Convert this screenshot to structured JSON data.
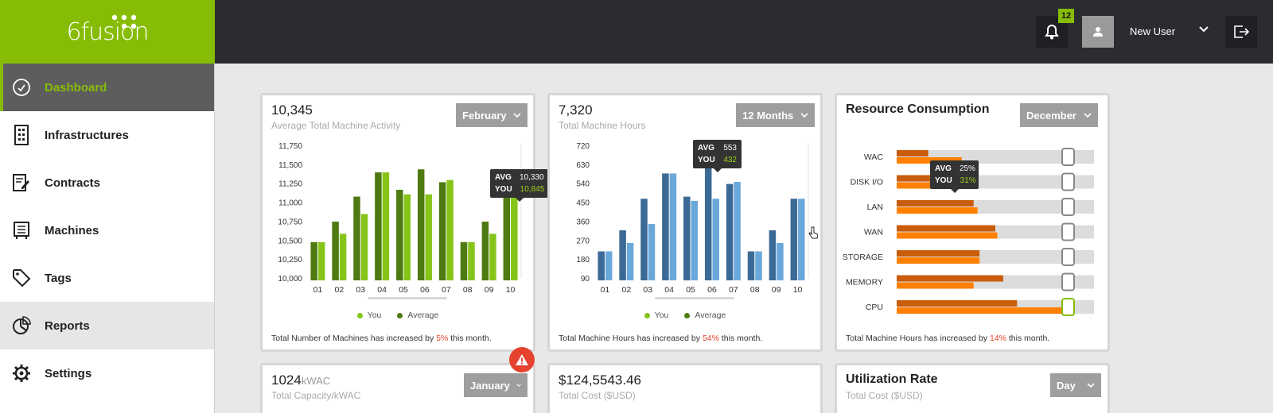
{
  "brand": {
    "logo_text": "6fusion"
  },
  "sidebar": {
    "items": [
      {
        "label": "Dashboard",
        "icon": "dashboard-icon"
      },
      {
        "label": "Infrastructures",
        "icon": "building-icon"
      },
      {
        "label": "Contracts",
        "icon": "contract-icon"
      },
      {
        "label": "Machines",
        "icon": "machine-icon"
      },
      {
        "label": "Tags",
        "icon": "tag-icon"
      },
      {
        "label": "Reports",
        "icon": "pie-chart-icon"
      },
      {
        "label": "Settings",
        "icon": "gear-icon"
      }
    ]
  },
  "topbar": {
    "notification_count": "12",
    "user_name": "New User"
  },
  "colors": {
    "brand_green": "#86bc05",
    "dark": "#2b2c30",
    "alert_red": "#e5432f",
    "avg_green": "#4f7a12",
    "you_green": "#86c41a",
    "avg_blue": "#3c6a96",
    "you_blue": "#6aa8dc",
    "avg_orange": "#c95d0c",
    "you_orange": "#ff8000"
  },
  "cards": {
    "activity": {
      "value": "10,345",
      "subtitle": "Average Total Machine Activity",
      "dropdown": "February",
      "footer_pre": "Total Number of Machines has increased by ",
      "footer_pct": "5%",
      "footer_post": " this month.",
      "tooltip": {
        "avg_label": "AVG",
        "avg": "10,330",
        "you_label": "YOU",
        "you": "10,845"
      },
      "legend": [
        "You",
        "Average"
      ]
    },
    "hours": {
      "value": "7,320",
      "subtitle": "Total Machine Hours",
      "dropdown": "12 Months",
      "footer_pre": "Total Machine Hours has increased by ",
      "footer_pct": "54%",
      "footer_post": " this month.",
      "tooltip": {
        "avg_label": "AVG",
        "avg": "553",
        "you_label": "YOU",
        "you": "432"
      },
      "legend": [
        "You",
        "Average"
      ]
    },
    "resource": {
      "title": "Resource Consumption",
      "dropdown": "December",
      "footer_pre": "Total Machine Hours has increased by ",
      "footer_pct": "14%",
      "footer_post": " this month.",
      "tooltip": {
        "avg_label": "AVG",
        "avg": "25%",
        "you_label": "YOU",
        "you": "31%"
      }
    },
    "capacity": {
      "value": "1024",
      "unit": "kWAC",
      "subtitle": "Total Capacity/kWAC",
      "dropdown": "January"
    },
    "cost": {
      "value": "$124,5543.46",
      "subtitle": "Total Cost ($USD)"
    },
    "utilization": {
      "title": "Utilization Rate",
      "subtitle": "Total Cost ($USD)",
      "dropdown": "Day"
    }
  },
  "chart_data": [
    {
      "type": "bar",
      "categories": [
        "01",
        "02",
        "03",
        "04",
        "05",
        "06",
        "07",
        "08",
        "09",
        "10"
      ],
      "y_ticks": [
        "11,750",
        "11,500",
        "11,250",
        "11,000",
        "10,750",
        "10,500",
        "10,250",
        "10,000"
      ],
      "ylim": [
        10000,
        11750
      ],
      "series": [
        {
          "name": "Average",
          "values": [
            10400,
            10670,
            11000,
            11320,
            11090,
            11360,
            11190,
            10400,
            10670,
            11000
          ]
        },
        {
          "name": "You",
          "values": [
            10400,
            10510,
            10770,
            11320,
            11030,
            11030,
            11220,
            10400,
            10510,
            11000
          ]
        }
      ]
    },
    {
      "type": "bar",
      "categories": [
        "01",
        "02",
        "03",
        "04",
        "05",
        "06",
        "07",
        "08",
        "09",
        "10"
      ],
      "y_ticks": [
        "720",
        "630",
        "540",
        "450",
        "360",
        "270",
        "180",
        "90"
      ],
      "ylim": [
        90,
        720
      ],
      "series": [
        {
          "name": "Average",
          "values": [
            190,
            290,
            440,
            560,
            450,
            620,
            510,
            190,
            290,
            440
          ]
        },
        {
          "name": "You",
          "values": [
            190,
            230,
            320,
            560,
            430,
            440,
            520,
            190,
            230,
            440
          ]
        }
      ]
    },
    {
      "type": "bar",
      "categories": [
        "WAC",
        "DISK I/O",
        "LAN",
        "WAN",
        "STORAGE",
        "MEMORY",
        "CPU"
      ],
      "series": [
        {
          "name": "Average",
          "values": [
            16,
            27,
            39,
            50,
            42,
            54,
            61
          ]
        },
        {
          "name": "You",
          "values": [
            33,
            31,
            41,
            51,
            42,
            39,
            86
          ]
        }
      ],
      "xlim": [
        0,
        100
      ]
    }
  ]
}
